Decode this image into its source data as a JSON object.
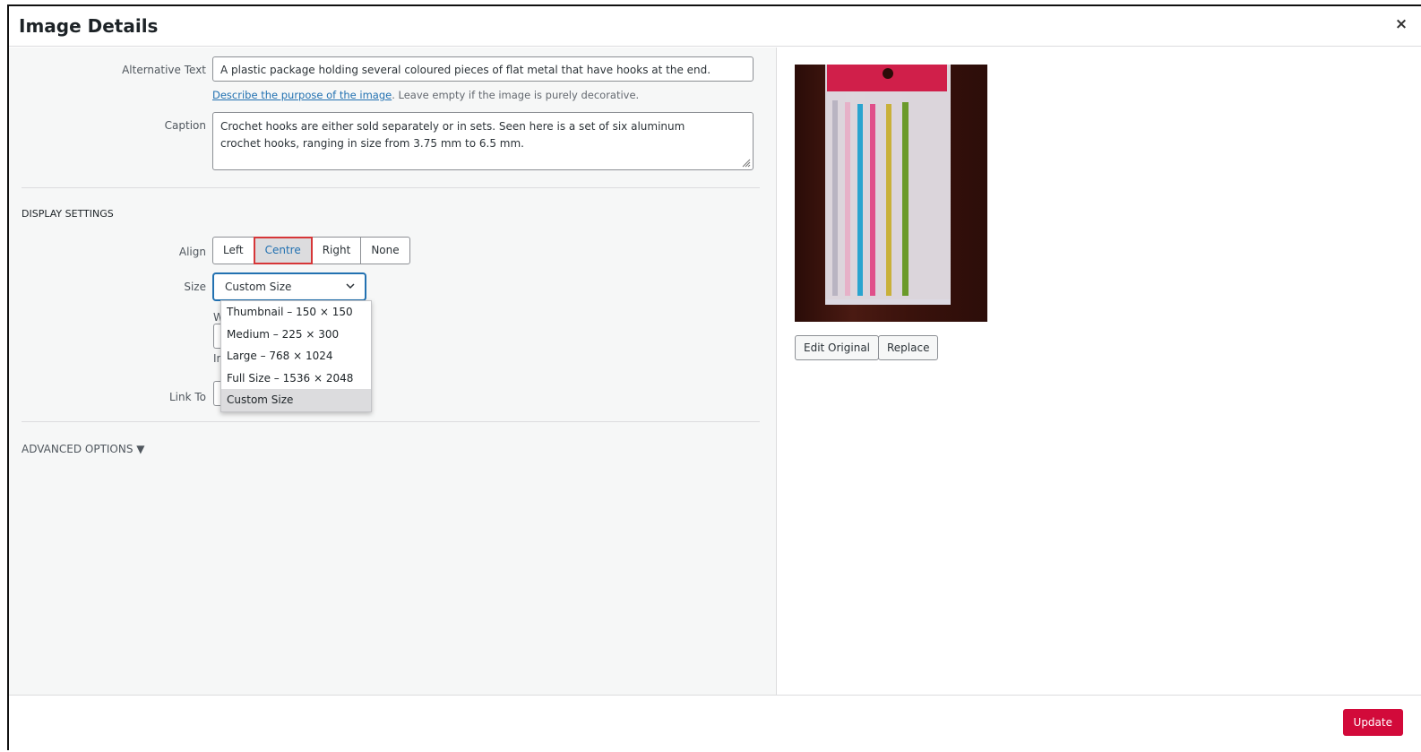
{
  "dialog": {
    "title": "Image Details",
    "close_label": "×"
  },
  "form": {
    "alt_label": "Alternative Text",
    "alt_value": "A plastic package holding several coloured pieces of flat metal that have hooks at the end.",
    "alt_help_link": "Describe the purpose of the image",
    "alt_help_rest": ". Leave empty if the image is purely decorative.",
    "caption_label": "Caption",
    "caption_value": "Crochet hooks are either sold separately or in sets. Seen here is a set of six aluminum crochet hooks, ranging in size from 3.75 mm to 6.5 mm."
  },
  "display": {
    "section_title": "DISPLAY SETTINGS",
    "align_label": "Align",
    "align_options": [
      "Left",
      "Centre",
      "Right",
      "None"
    ],
    "align_selected": "Centre",
    "size_label": "Size",
    "size_value": "Custom Size",
    "size_options": [
      "Thumbnail – 150 × 150",
      "Medium – 225 × 300",
      "Large – 768 × 1024",
      "Full Size – 1536 × 2048",
      "Custom Size"
    ],
    "hidden_width_initial": "W",
    "hidden_help_initial": "In",
    "link_label": "Link To"
  },
  "advanced": {
    "label": "ADVANCED OPTIONS ▼"
  },
  "sidebar": {
    "edit_original": "Edit Original",
    "replace": "Replace"
  },
  "footer": {
    "update_label": "Update"
  },
  "colors": {
    "accent": "#2271b1",
    "update": "#d20a3a",
    "active_border": "#d63638"
  }
}
